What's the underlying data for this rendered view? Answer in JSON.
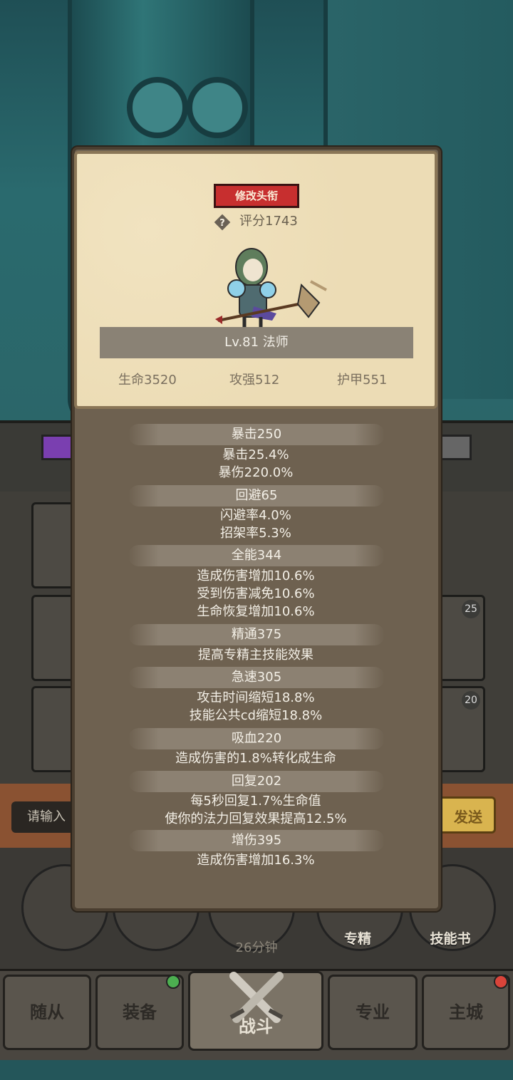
{
  "profile": {
    "title_button": "修改头衔",
    "score": "评分1743",
    "level_class": "Lv.81 法师",
    "base_stats": [
      "生命3520",
      "攻强512",
      "护甲551"
    ]
  },
  "stat_groups": [
    {
      "header": "暴击250",
      "lines": [
        "暴击25.4%",
        "暴伤220.0%"
      ]
    },
    {
      "header": "回避65",
      "lines": [
        "闪避率4.0%",
        "招架率5.3%"
      ]
    },
    {
      "header": "全能344",
      "lines": [
        "造成伤害增加10.6%",
        "受到伤害减免10.6%",
        "生命恢复增加10.6%"
      ]
    },
    {
      "header": "精通375",
      "lines": [
        "提高专精主技能效果"
      ]
    },
    {
      "header": "急速305",
      "lines": [
        "攻击时间缩短18.8%",
        "技能公共cd缩短18.8%"
      ]
    },
    {
      "header": "吸血220",
      "lines": [
        "造成伤害的1.8%转化成生命"
      ]
    },
    {
      "header": "回复202",
      "lines": [
        "每5秒回复1.7%生命值",
        "使你的法力回复效果提高12.5%"
      ]
    },
    {
      "header": "增伤395",
      "lines": [
        "造成伤害增加16.3%"
      ]
    }
  ],
  "background": {
    "slot_badges": [
      "25",
      "20"
    ],
    "chat_placeholder": "请输入",
    "send_label": "发送",
    "circle_buttons": [
      "专精",
      "技能书"
    ],
    "timer": "26分钟",
    "nav_tabs": [
      "随从",
      "装备",
      "战斗",
      "专业",
      "主城"
    ]
  },
  "colors": {
    "accent_red": "#c72f2f",
    "notify_green": "#4caf50",
    "notify_red": "#d9443a"
  },
  "icons": {
    "help": "question-diamond-icon",
    "battle": "crossed-swords-icon"
  }
}
